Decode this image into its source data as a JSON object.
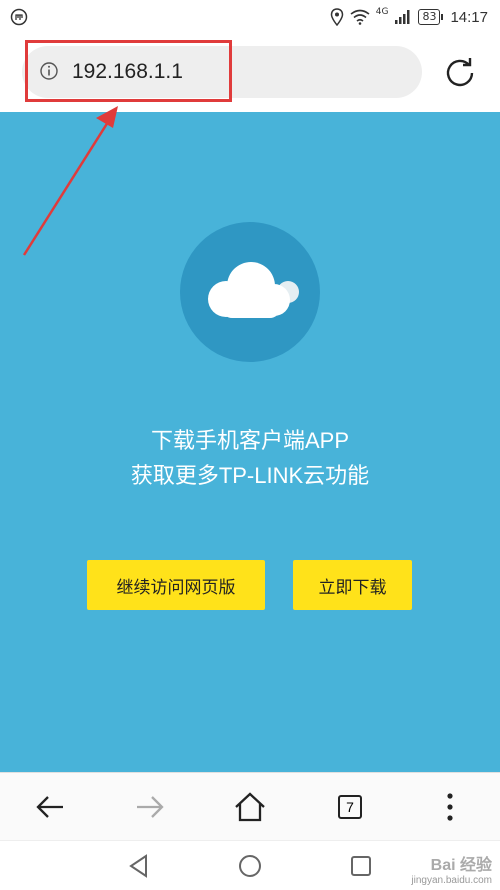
{
  "status_bar": {
    "network": "4G",
    "battery": "83",
    "time": "14:17"
  },
  "address_bar": {
    "url": "192.168.1.1"
  },
  "page": {
    "line1": "下载手机客户端APP",
    "line2": "获取更多TP-LINK云功能",
    "continue_button": "继续访问网页版",
    "download_button": "立即下载"
  },
  "toolbar": {
    "tab_count": "7"
  },
  "watermark": {
    "logo": "Bai 经验",
    "site": "jingyan.baidu.com"
  },
  "colors": {
    "background": "#48b3d9",
    "circle": "#2f97c3",
    "button": "#ffe21a",
    "annotation": "#e03b3b"
  },
  "icons": [
    "app-notification-icon",
    "location-icon",
    "wifi-icon",
    "signal-icon",
    "battery-icon",
    "info-icon",
    "reload-icon",
    "cloud-icon",
    "back-icon",
    "forward-icon",
    "home-icon",
    "menu-icon",
    "nav-back-icon",
    "nav-home-icon",
    "nav-recents-icon"
  ]
}
